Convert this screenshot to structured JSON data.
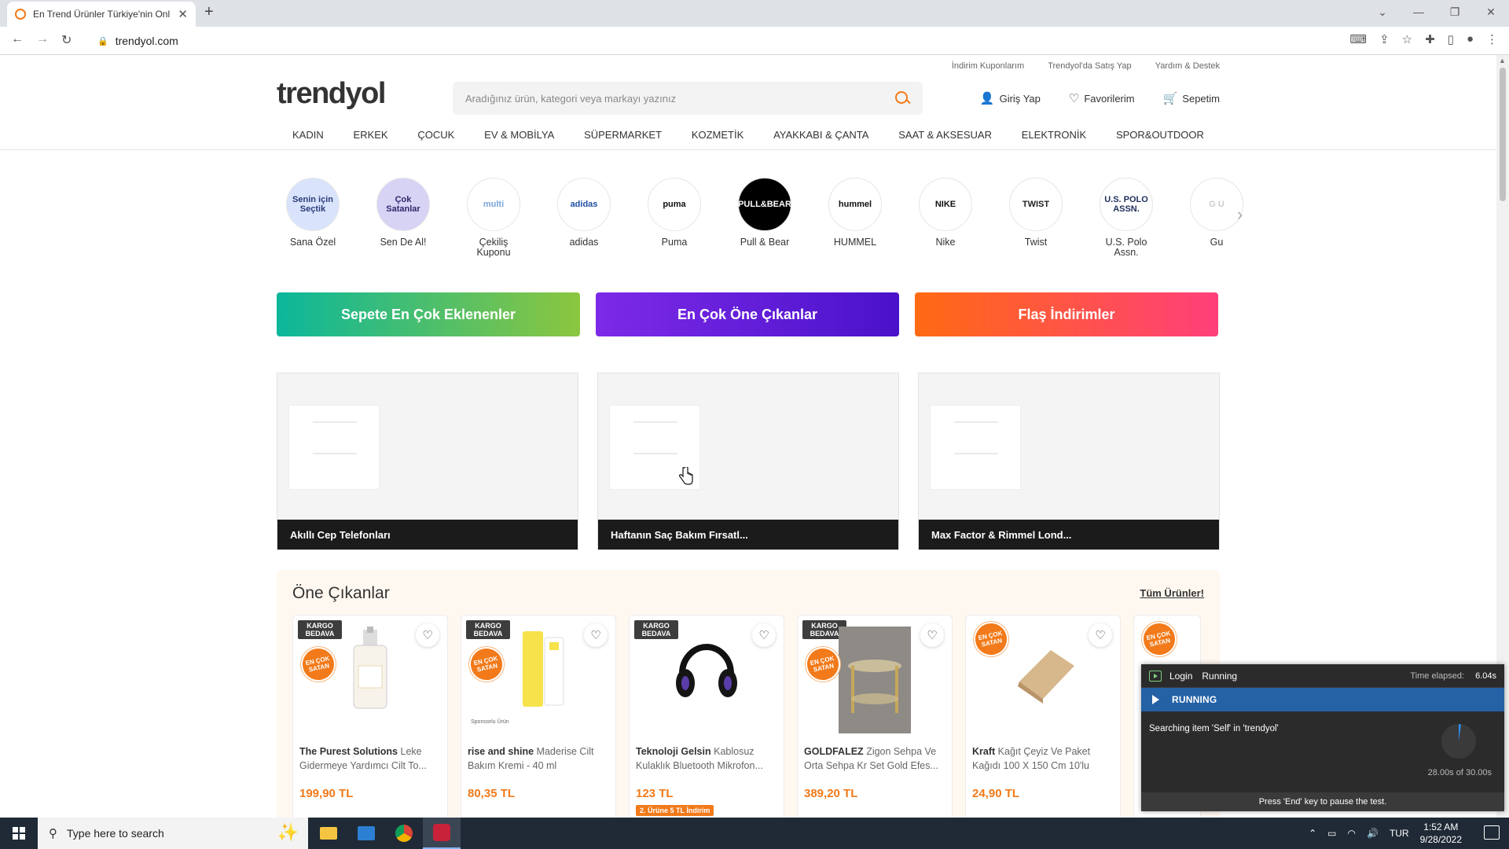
{
  "browser": {
    "tab_title": "En Trend Ürünler Türkiye'nin Onl",
    "new_tab": "+",
    "url": "trendyol.com",
    "window_controls": [
      "⌄",
      "—",
      "❐",
      "✕"
    ]
  },
  "header": {
    "top_links": [
      "İndirim Kuponlarım",
      "Trendyol'da Satış Yap",
      "Yardım & Destek"
    ],
    "logo": "trendyol",
    "search_placeholder": "Aradığınız ürün, kategori veya markayı yazınız",
    "login": "Giriş Yap",
    "favorites": "Favorilerim",
    "cart": "Sepetim"
  },
  "categories": [
    "KADIN",
    "ERKEK",
    "ÇOCUK",
    "EV & MOBİLYA",
    "SÜPERMARKET",
    "KOZMETİK",
    "AYAKKABI & ÇANTA",
    "SAAT & AKSESUAR",
    "ELEKTRONİK",
    "SPOR&OUTDOOR"
  ],
  "stories": [
    {
      "label": "Sana Özel",
      "badge": "Senin için Seçtik",
      "bg": "#d9e3fb",
      "fg": "#2b3b7a"
    },
    {
      "label": "Sen De Al!",
      "badge": "Çok Satanlar",
      "bg": "#d7d3f5",
      "fg": "#2e2a6b"
    },
    {
      "label": "Çekiliş Kuponu",
      "badge": "multi",
      "bg": "#ffffff",
      "fg": "#7aa6d8"
    },
    {
      "label": "adidas",
      "badge": "adidas",
      "bg": "#ffffff",
      "fg": "#1f4fa5"
    },
    {
      "label": "Puma",
      "badge": "puma",
      "bg": "#ffffff",
      "fg": "#111111"
    },
    {
      "label": "Pull & Bear",
      "badge": "PULL&BEAR",
      "bg": "#000000",
      "fg": "#ffffff"
    },
    {
      "label": "HUMMEL",
      "badge": "hummel",
      "bg": "#ffffff",
      "fg": "#111111"
    },
    {
      "label": "Nike",
      "badge": "NIKE",
      "bg": "#ffffff",
      "fg": "#111111"
    },
    {
      "label": "Twist",
      "badge": "TWIST",
      "bg": "#ffffff",
      "fg": "#222222"
    },
    {
      "label": "U.S. Polo Assn.",
      "badge": "U.S. POLO ASSN.",
      "bg": "#ffffff",
      "fg": "#1d2f5a"
    },
    {
      "label": "Gu",
      "badge": "G U",
      "bg": "#ffffff",
      "fg": "#cccccc"
    }
  ],
  "promos": [
    {
      "label": "Sepete En Çok Eklenenler",
      "gradient": "linear-gradient(90deg,#0bb79b,#8cc63f)"
    },
    {
      "label": "En Çok Öne Çıkanlar",
      "gradient": "linear-gradient(90deg,#7d2ae8,#4a12c9)"
    },
    {
      "label": "Flaş İndirimler",
      "gradient": "linear-gradient(90deg,#ff6a13,#ff3f7a)"
    }
  ],
  "banners": [
    "Akıllı Cep Telefonları",
    "Haftanın Saç Bakım Fırsatl...",
    "Max Factor & Rimmel Lond..."
  ],
  "featured": {
    "title": "Öne Çıkanlar",
    "all_link": "Tüm Ürünler!",
    "kargo_badge": "KARGO BEDAVA",
    "encok_badge": "EN ÇOK SATAN",
    "products": [
      {
        "brand": "The Purest Solutions",
        "name": "Leke Gidermeye Yardımcı Cilt To...",
        "price": "199,90 TL",
        "kargo": true,
        "encok": true
      },
      {
        "brand": "rise and shine",
        "name": "Maderise Cilt Bakım Kremi - 40 ml",
        "price": "80,35 TL",
        "kargo": true,
        "encok": true,
        "sponsor": "Sponsorlu Ürün"
      },
      {
        "brand": "Teknoloji Gelsin",
        "name": "Kablosuz Kulaklık Bluetooth Mikrofon...",
        "price": "123 TL",
        "kargo": true,
        "encok": false,
        "discount": "2. Ürüne 5 TL İndirim"
      },
      {
        "brand": "GOLDFALEZ",
        "name": "Zigon Sehpa Ve Orta Sehpa Kr Set Gold Efes...",
        "price": "389,20 TL",
        "kargo": true,
        "encok": true
      },
      {
        "brand": "Kraft",
        "name": "Kağıt Çeyiz Ve Paket Kağıdı 100 X 150 Cm 10'lu",
        "price": "24,90 TL",
        "kargo": false,
        "encok": true
      },
      {
        "brand": "",
        "name": "",
        "price": "",
        "kargo": false,
        "encok": true
      }
    ]
  },
  "runner": {
    "test_name": "Login",
    "test_state": "Running",
    "elapsed_label": "Time elapsed:",
    "elapsed": "6.04s",
    "status": "RUNNING",
    "message": "Searching item 'Self' in 'trendyol'",
    "timeout": "28.00s of 30.00s",
    "footer": "Press 'End' key to pause the test."
  },
  "taskbar": {
    "search_placeholder": "Type here to search",
    "language": "TUR",
    "time": "1:52 AM",
    "date": "9/28/2022"
  },
  "colors": {
    "accent": "#f27a1a",
    "runner_status": "#2461a5"
  }
}
